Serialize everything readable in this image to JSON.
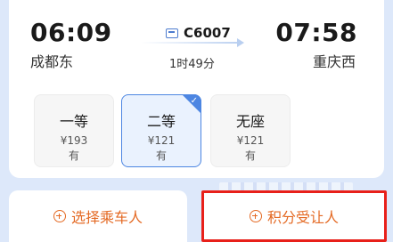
{
  "journey": {
    "departure_time": "06:09",
    "departure_station": "成都东",
    "arrival_time": "07:58",
    "arrival_station": "重庆西",
    "train_number": "C6007",
    "duration": "1时49分"
  },
  "seats": [
    {
      "class": "一等",
      "price": "¥193",
      "availability": "有",
      "selected": false
    },
    {
      "class": "二等",
      "price": "¥121",
      "availability": "有",
      "selected": true
    },
    {
      "class": "无座",
      "price": "¥121",
      "availability": "有",
      "selected": false
    }
  ],
  "actions": {
    "select_passenger": "选择乘车人",
    "points_recipient": "积分受让人"
  },
  "colors": {
    "accent": "#e46a24",
    "selected": "#4d86e2",
    "highlight_border": "#e8201a"
  }
}
